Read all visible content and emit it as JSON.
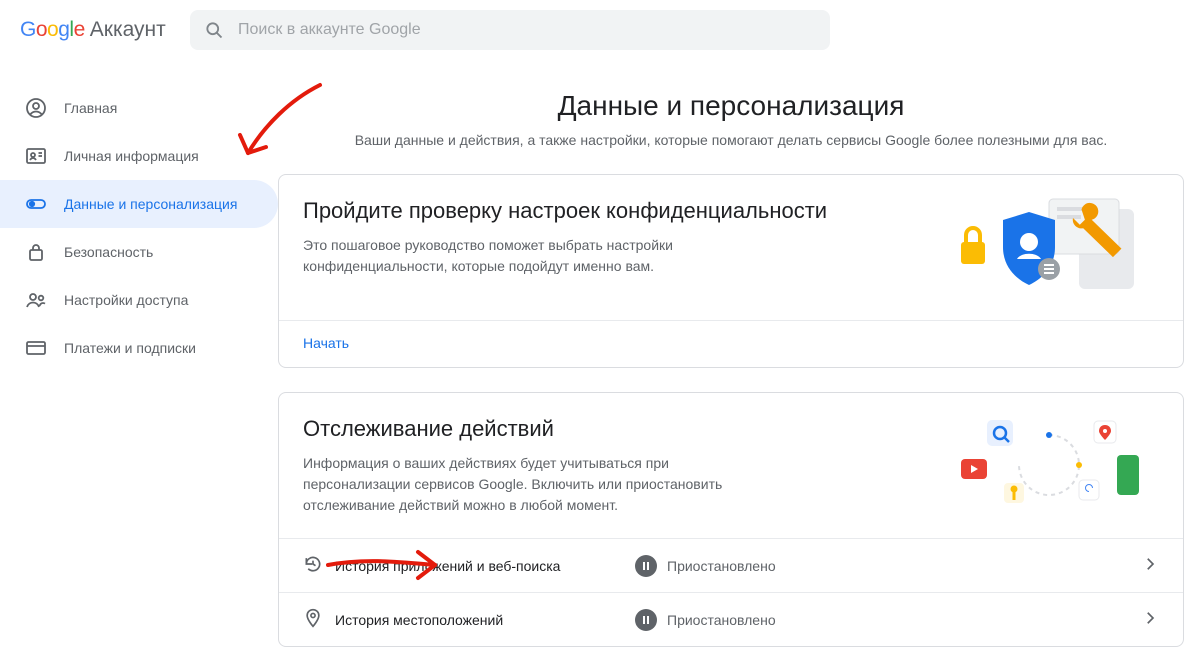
{
  "header": {
    "logo_sub": "Аккаунт",
    "search_placeholder": "Поиск в аккаунте Google"
  },
  "sidebar": {
    "items": [
      {
        "label": "Главная"
      },
      {
        "label": "Личная информация"
      },
      {
        "label": "Данные и персонализация"
      },
      {
        "label": "Безопасность"
      },
      {
        "label": "Настройки доступа"
      },
      {
        "label": "Платежи и подписки"
      }
    ]
  },
  "main": {
    "title": "Данные и персонализация",
    "subtitle": "Ваши данные и действия, а также настройки, которые помогают делать сервисы Google более полезными для вас."
  },
  "privacy_card": {
    "title": "Пройдите проверку настроек конфиденциальности",
    "desc": "Это пошаговое руководство поможет выбрать настройки конфиденциальности, которые подойдут именно вам.",
    "action": "Начать"
  },
  "activity_card": {
    "title": "Отслеживание действий",
    "desc": "Информация о ваших действиях будет учитываться при персонализации сервисов Google. Включить или приостановить отслеживание действий можно в любой момент.",
    "rows": [
      {
        "label": "История приложений и веб-поиска",
        "status": "Приостановлено"
      },
      {
        "label": "История местоположений",
        "status": "Приостановлено"
      }
    ]
  }
}
